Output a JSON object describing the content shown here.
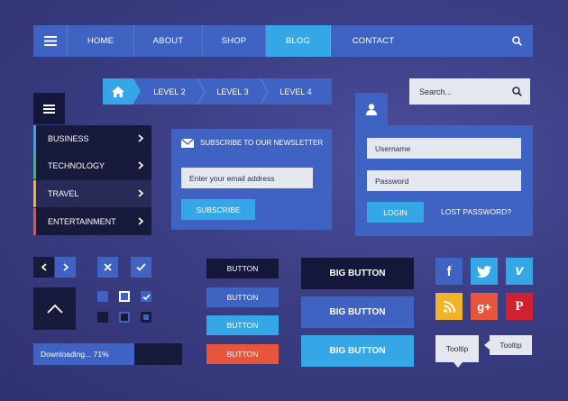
{
  "nav": {
    "items": [
      {
        "label": "HOME"
      },
      {
        "label": "ABOUT"
      },
      {
        "label": "SHOP"
      },
      {
        "label": "BLOG"
      },
      {
        "label": "CONTACT"
      }
    ],
    "active": "BLOG"
  },
  "breadcrumb": {
    "items": [
      {
        "label": "LEVEL 2"
      },
      {
        "label": "LEVEL 3"
      },
      {
        "label": "LEVEL 4"
      }
    ]
  },
  "search": {
    "placeholder": "Search..."
  },
  "sidemenu": {
    "items": [
      {
        "label": "BUSINESS",
        "color": "#36a7e6"
      },
      {
        "label": "TECHNOLOGY",
        "color": "#2fbf71"
      },
      {
        "label": "TRAVEL",
        "color": "#f0b32a"
      },
      {
        "label": "ENTERTAINMENT",
        "color": "#e8553d"
      }
    ]
  },
  "newsletter": {
    "title": "SUBSCRIBE TO OUR NEWSLETTER",
    "email_placeholder": "Enter your email address",
    "button": "SUBSCRIBE"
  },
  "login": {
    "username_placeholder": "Username",
    "password_placeholder": "Password",
    "button": "LOGIN",
    "lost": "LOST PASSWORD?"
  },
  "progress": {
    "label": "Downloading... 71%",
    "value": 0.71
  },
  "small_buttons": [
    {
      "label": "BUTTON"
    },
    {
      "label": "BUTTON"
    },
    {
      "label": "BUTTON"
    },
    {
      "label": "BUTTON"
    }
  ],
  "big_buttons": [
    {
      "label": "BIG BUTTON"
    },
    {
      "label": "BIG BUTTON"
    },
    {
      "label": "BIG BUTTON"
    }
  ],
  "social": {
    "facebook": "f",
    "vimeo": "v",
    "google_plus": "g+",
    "pinterest": "P"
  },
  "tooltips": [
    {
      "label": "Tooltip"
    },
    {
      "label": "Tooltip"
    }
  ],
  "colors": {
    "primary": "#3f63c3",
    "accent": "#36a7e6",
    "dark": "#181a3c",
    "danger": "#e8553d"
  }
}
